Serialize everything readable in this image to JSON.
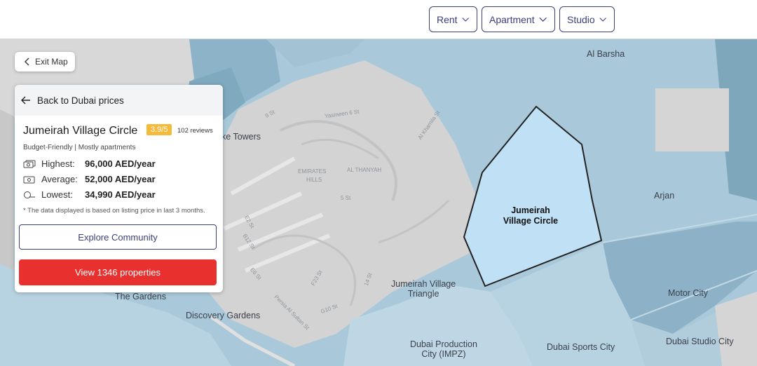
{
  "filters": {
    "purpose": "Rent",
    "property_type": "Apartment",
    "bedrooms": "Studio"
  },
  "map": {
    "exit_label": "Exit Map",
    "areas": {
      "al_barsha": "Al Barsha",
      "arjan": "Arjan",
      "motor_city": "Motor City",
      "jvt_line1": "Jumeirah Village",
      "jvt_line2": "Triangle",
      "the_gardens": "The Gardens",
      "discovery_gardens": "Discovery Gardens",
      "impz_line1": "Dubai Production",
      "impz_line2": "City (IMPZ)",
      "sports_city": "Dubai Sports City",
      "studio_city": "Dubai Studio City",
      "towers": "ke Towers"
    },
    "selected_line1": "Jumeirah",
    "selected_line2": "Village Circle",
    "streets": {
      "s1": "9 St",
      "s2": "Yasmeen 6 St",
      "s3": "Al Khamila St",
      "s4": "EMIRATES",
      "s5": "AL THANYAH",
      "s6": "HILLS",
      "s7": "E2 St",
      "s8": "B12 St",
      "s9": "E6 St",
      "s10": "F23 St",
      "s11": "G10 St",
      "s12": "Persia Al Sultan St",
      "s13": "5 St",
      "s14": "14 St"
    }
  },
  "panel": {
    "back_label": "Back to Dubai prices",
    "community_name": "Jumeirah Village Circle",
    "rating": "3.9/5",
    "reviews": "102 reviews",
    "tags": "Budget-Friendly | Mostly apartments",
    "highest_label": "Highest:",
    "highest_value": "96,000 AED/year",
    "average_label": "Average:",
    "average_value": "52,000 AED/year",
    "lowest_label": "Lowest:",
    "lowest_value": "34,990 AED/year",
    "note": "* The data displayed is based on listing price in last 3 months.",
    "explore_label": "Explore Community",
    "view_label": "View 1346 properties"
  },
  "colors": {
    "accent": "#3b3f7a",
    "cta": "#e8312f",
    "rating": "#f5b93b",
    "selected_area": "#bfe0f5"
  }
}
